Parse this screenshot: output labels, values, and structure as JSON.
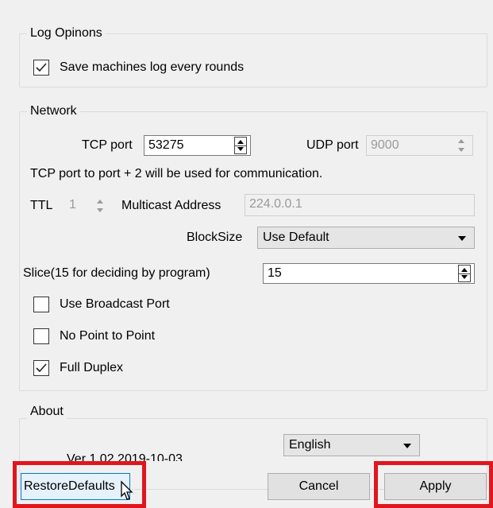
{
  "log_options": {
    "title": "Log Opinons",
    "save_log_label": "Save machines log every rounds",
    "save_log_checked": true
  },
  "network": {
    "title": "Network",
    "tcp_port_label": "TCP port",
    "tcp_port_value": "53275",
    "udp_port_label": "UDP port",
    "udp_port_value": "9000",
    "info_text": "TCP port to port + 2 will be used for communication.",
    "ttl_label": "TTL",
    "ttl_value": "1",
    "multicast_label": "Multicast Address",
    "multicast_value": "224.0.0.1",
    "blocksize_label": "BlockSize",
    "blocksize_value": "Use Default",
    "slice_label": "Slice(15 for deciding by program)",
    "slice_value": "15",
    "broadcast_label": "Use Broadcast Port",
    "broadcast_checked": false,
    "p2p_label": "No Point to Point",
    "p2p_checked": false,
    "duplex_label": "Full Duplex",
    "duplex_checked": true
  },
  "about": {
    "title": "About",
    "version_partial": "Ver 1.02 2019-10-03",
    "language_value": "English"
  },
  "buttons": {
    "restore": "RestoreDefaults",
    "cancel": "Cancel",
    "apply": "Apply"
  },
  "colors": {
    "highlight": "#e0161e",
    "focus_border": "#0078d7"
  }
}
